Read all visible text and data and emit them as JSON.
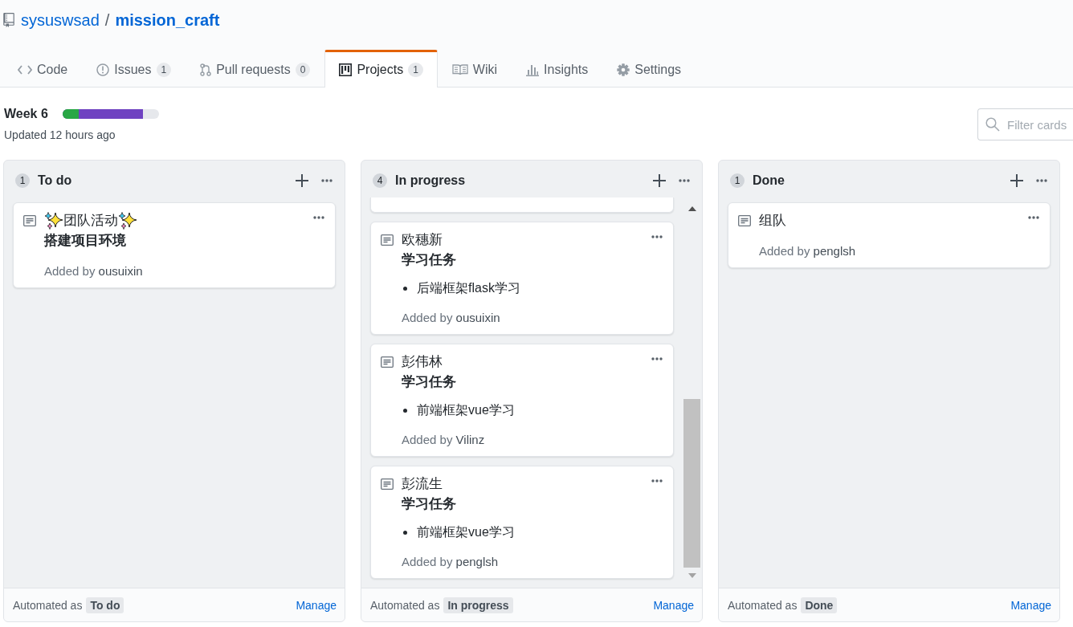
{
  "repo": {
    "owner": "sysuswsad",
    "separator": "/",
    "name": "mission_craft"
  },
  "tabs": [
    {
      "kind": "code",
      "label": "Code",
      "selected": false
    },
    {
      "kind": "issues",
      "label": "Issues",
      "counter": "1",
      "selected": false
    },
    {
      "kind": "pull_requests",
      "label": "Pull requests",
      "counter": "0",
      "selected": false
    },
    {
      "kind": "projects",
      "label": "Projects",
      "counter": "1",
      "selected": true
    },
    {
      "kind": "wiki",
      "label": "Wiki",
      "selected": false
    },
    {
      "kind": "insights",
      "label": "Insights",
      "selected": false
    },
    {
      "kind": "settings",
      "label": "Settings",
      "selected": false
    }
  ],
  "project": {
    "title": "Week 6",
    "progress": [
      {
        "color": "#6f42c1",
        "level": 0.833
      },
      {
        "color": "#28a745",
        "level": 0.167
      }
    ],
    "updated": "Updated 12 hours ago"
  },
  "filter": {
    "placeholder": "Filter cards"
  },
  "columns": [
    {
      "count": "1",
      "title": "To do",
      "scrollable": false,
      "cards": [
        {
          "kind": "note",
          "emoji_wrapped": true,
          "title": "团队活动",
          "heading": "搭建项目环境",
          "added_by": "Added by",
          "author": "ousuixin"
        }
      ],
      "footer": {
        "label": "Automated as",
        "preset": "To do",
        "link": "Manage"
      }
    },
    {
      "count": "4",
      "title": "In progress",
      "scrollable": true,
      "cards": [
        {
          "kind": "clipped"
        },
        {
          "kind": "note",
          "emoji_wrapped": false,
          "title": "欧穗新",
          "heading": "学习任务",
          "bullets": [
            "后端框架flask学习"
          ],
          "added_by": "Added by",
          "author": "ousuixin"
        },
        {
          "kind": "note",
          "emoji_wrapped": false,
          "title": "彭伟林",
          "heading": "学习任务",
          "bullets": [
            "前端框架vue学习"
          ],
          "added_by": "Added by",
          "author": "Vilinz"
        },
        {
          "kind": "note",
          "emoji_wrapped": false,
          "title": "彭流生",
          "heading": "学习任务",
          "bullets": [
            "前端框架vue学习"
          ],
          "added_by": "Added by",
          "author": "penglsh"
        }
      ],
      "footer": {
        "label": "Automated as",
        "preset": "In progress",
        "link": "Manage"
      }
    },
    {
      "count": "1",
      "title": "Done",
      "scrollable": false,
      "cards": [
        {
          "kind": "note",
          "emoji_wrapped": false,
          "title": "组队",
          "added_by": "Added by",
          "author": "penglsh"
        }
      ],
      "footer": {
        "label": "Automated as",
        "preset": "Done",
        "link": "Manage"
      }
    }
  ]
}
